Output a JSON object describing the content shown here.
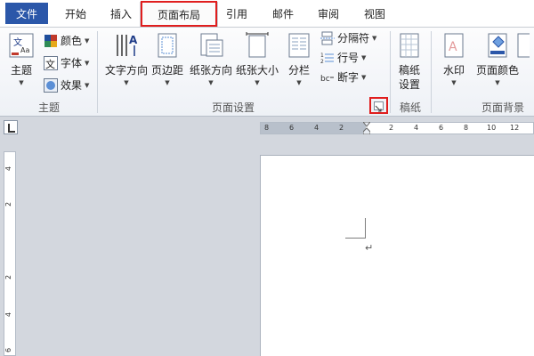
{
  "tabs": {
    "file": "文件",
    "start": "开始",
    "insert": "插入",
    "layout": "页面布局",
    "references": "引用",
    "mailings": "邮件",
    "review": "审阅",
    "view": "视图"
  },
  "theme_group": {
    "theme": "主题",
    "colors": "颜色",
    "fonts": "字体",
    "effects": "效果",
    "label": "主题"
  },
  "page_setup": {
    "text_direction": "文字方向",
    "margins": "页边距",
    "orientation": "纸张方向",
    "size": "纸张大小",
    "columns": "分栏",
    "breaks": "分隔符",
    "line_numbers": "行号",
    "hyphenation": "断字",
    "label": "页面设置"
  },
  "draft_group": {
    "line1": "稿纸",
    "line2": "设置",
    "label": "稿纸"
  },
  "background_group": {
    "watermark": "水印",
    "page_color": "页面颜色",
    "label": "页面背景"
  },
  "ruler": {
    "h_ticks": [
      "8",
      "6",
      "4",
      "2",
      "2",
      "4",
      "6",
      "8",
      "10",
      "12"
    ],
    "v_ticks": [
      "4",
      "2",
      "2",
      "4",
      "6"
    ]
  },
  "doc": {
    "paragraph_mark": "↵"
  },
  "colors": {
    "file_tab": "#2b57a9",
    "highlight": "#e01e1e",
    "workspace": "#d3d7de"
  }
}
